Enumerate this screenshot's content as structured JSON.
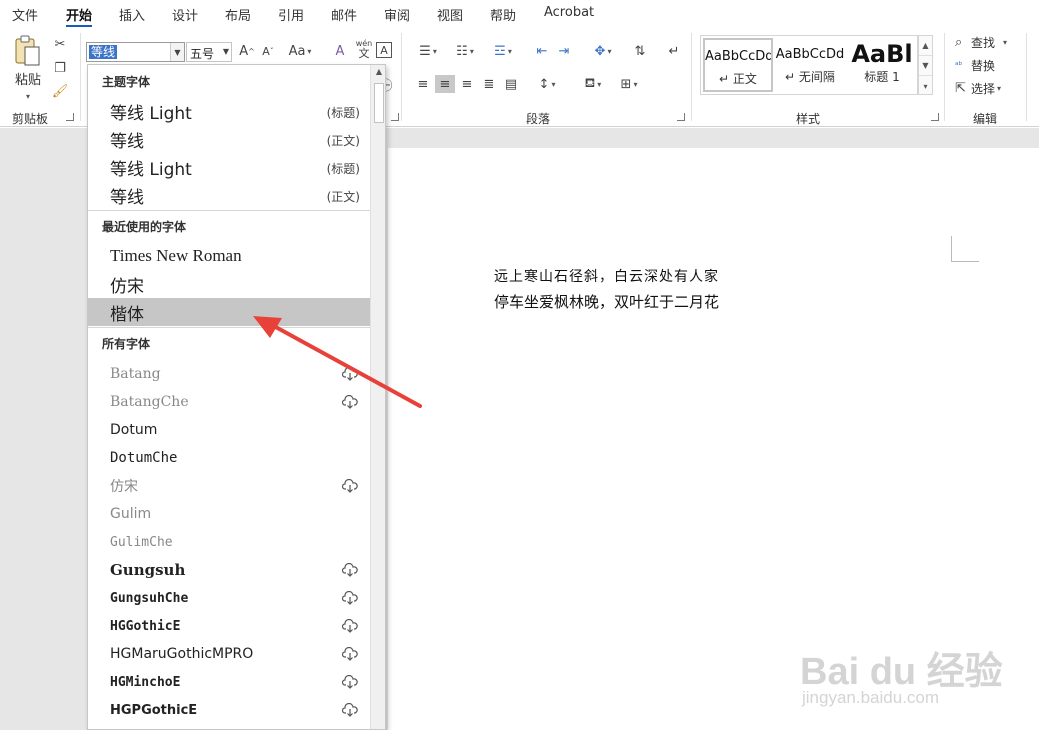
{
  "menu": {
    "tabs": [
      "文件",
      "开始",
      "插入",
      "设计",
      "布局",
      "引用",
      "邮件",
      "审阅",
      "视图",
      "帮助",
      "Acrobat"
    ],
    "active": "开始"
  },
  "clipboard": {
    "paste_label": "粘贴",
    "group_label": "剪贴板"
  },
  "font": {
    "name_value": "等线",
    "size_value": "五号",
    "grow_label": "A",
    "shrink_label": "A",
    "case_label": "Aa",
    "clear_label": "A",
    "phonetic_label": "wén",
    "border_label": "A"
  },
  "paragraph": {
    "group_label": "段落"
  },
  "styles": {
    "group_label": "样式",
    "items": [
      {
        "sample": "AaBbCcDd",
        "name": "正文"
      },
      {
        "sample": "AaBbCcDd",
        "name": "无间隔"
      },
      {
        "sample": "AaBl",
        "name": "标题 1"
      }
    ]
  },
  "editing": {
    "group_label": "编辑",
    "find": "查找",
    "replace": "替换",
    "select": "选择"
  },
  "document": {
    "line1": "远上寒山石径斜，白云深处有人家",
    "line2": "停车坐爱枫林晚，双叶红于二月花"
  },
  "dropdown": {
    "theme_header": "主题字体",
    "theme_fonts": [
      {
        "name": "等线 Light",
        "tag": "(标题)"
      },
      {
        "name": "等线",
        "tag": "(正文)"
      },
      {
        "name": "等线 Light",
        "tag": "(标题)"
      },
      {
        "name": "等线",
        "tag": "(正文)"
      }
    ],
    "recent_header": "最近使用的字体",
    "recent_fonts": [
      "Times New Roman",
      "仿宋",
      "楷体"
    ],
    "all_header": "所有字体",
    "all_fonts": [
      {
        "name": "Batang",
        "cloud": true
      },
      {
        "name": "BatangChe",
        "cloud": true
      },
      {
        "name": "Dotum",
        "cloud": false
      },
      {
        "name": "DotumChe",
        "cloud": false
      },
      {
        "name": "仿宋",
        "cloud": true
      },
      {
        "name": "Gulim",
        "cloud": false
      },
      {
        "name": "GulimChe",
        "cloud": false
      },
      {
        "name": "Gungsuh",
        "cloud": true
      },
      {
        "name": "GungsuhChe",
        "cloud": true
      },
      {
        "name": "HGGothicE",
        "cloud": true
      },
      {
        "name": "HGMaruGothicMPRO",
        "cloud": true
      },
      {
        "name": "HGMinchoE",
        "cloud": true
      },
      {
        "name": "HGPGothicE",
        "cloud": true
      }
    ]
  },
  "watermark": {
    "brand": "Bai du 经验",
    "url": "jingyan.baidu.com"
  },
  "colors": {
    "accent": "#185abd",
    "highlight": "#c6c6c6",
    "arrow": "#e8413a"
  }
}
